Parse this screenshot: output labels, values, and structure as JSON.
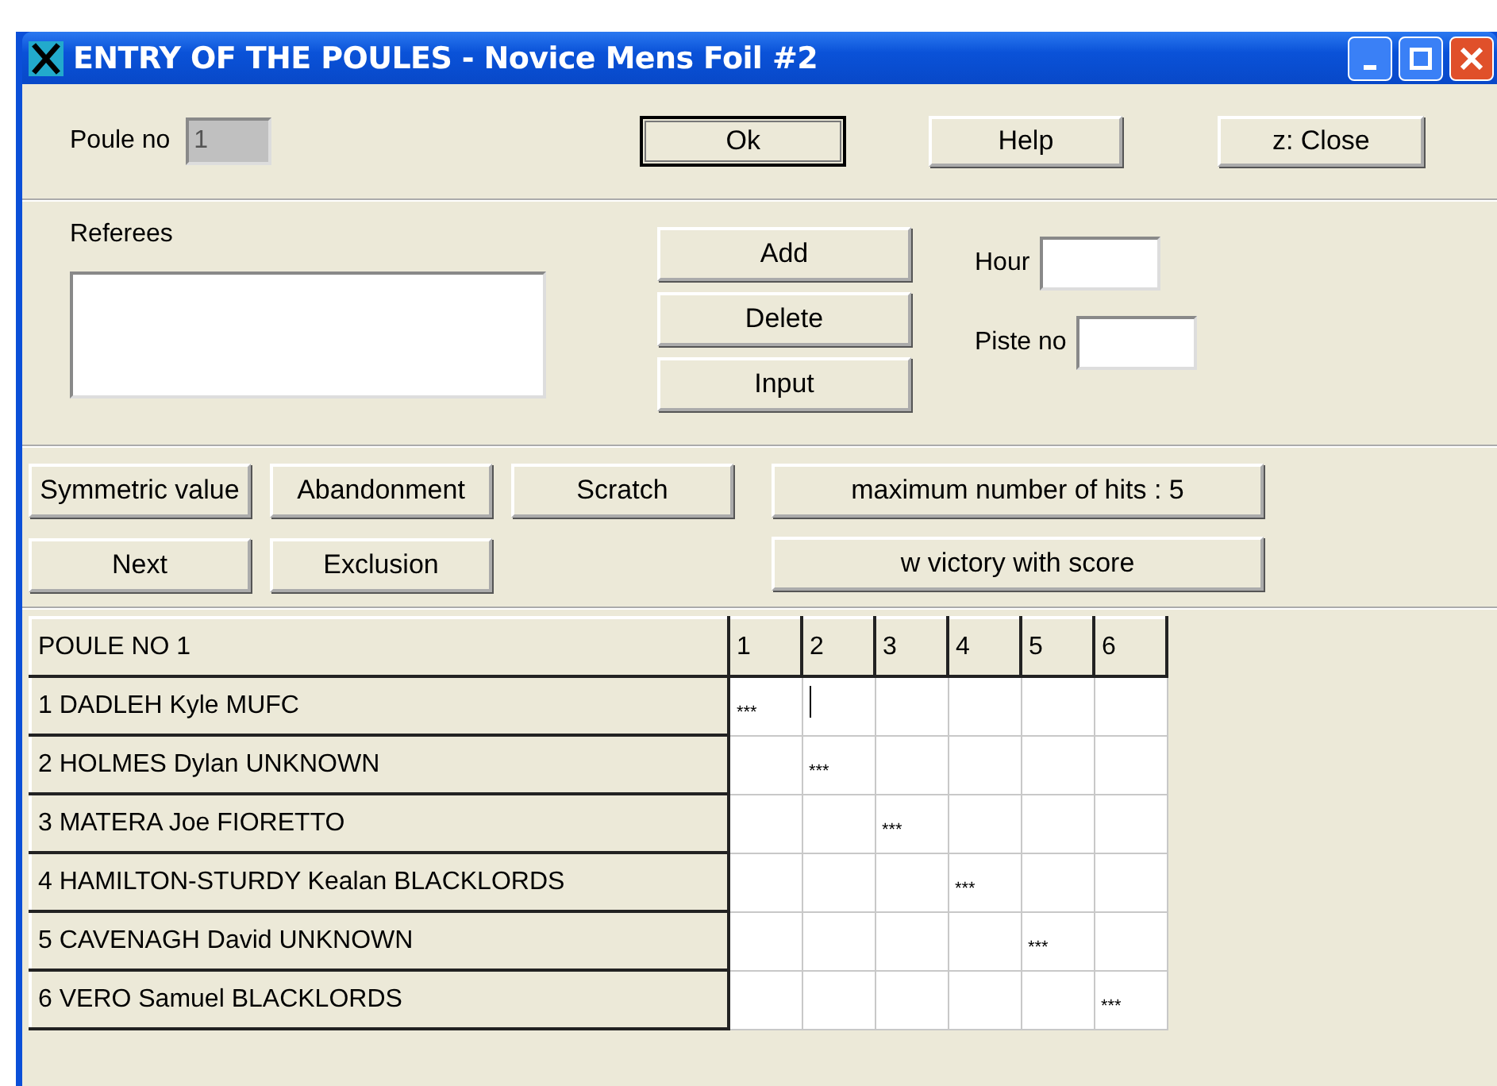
{
  "window": {
    "title": "ENTRY OF THE POULES - Novice Mens Foil #2"
  },
  "poule": {
    "label": "Poule no",
    "value": "1",
    "disabled": true
  },
  "top_buttons": [
    {
      "label": "Ok",
      "default": true
    },
    {
      "label": "Help",
      "default": false
    },
    {
      "label": "z: Close",
      "default": false
    }
  ],
  "referees": {
    "label": "Referees"
  },
  "referee_buttons": [
    "Add",
    "Delete",
    "Input"
  ],
  "hour": {
    "label": "Hour"
  },
  "piste": {
    "label": "Piste no"
  },
  "action_buttons": [
    "Symmetric value",
    "Abandonment",
    "Scratch",
    "Next",
    "Exclusion"
  ],
  "hits_button": "maximum number of hits : 5",
  "victory_button": "w victory with score",
  "grid": {
    "title": "POULE NO 1",
    "columns": [
      "1",
      "2",
      "3",
      "4",
      "5",
      "6"
    ],
    "rows": [
      {
        "label": "1  DADLEH Kyle  MUFC",
        "cells": [
          {
            "text": "***",
            "focused": false
          },
          {
            "focused": true
          },
          {
            "focused": false
          },
          {
            "focused": false
          },
          {
            "focused": false
          },
          {
            "focused": false
          }
        ]
      },
      {
        "label": "2  HOLMES Dylan  UNKNOWN",
        "cells": [
          {
            "focused": false
          },
          {
            "text": "***",
            "focused": false
          },
          {
            "focused": false
          },
          {
            "focused": false
          },
          {
            "focused": false
          },
          {
            "focused": false
          }
        ]
      },
      {
        "label": "3  MATERA Joe  FIORETTO",
        "cells": [
          {
            "focused": false
          },
          {
            "focused": false
          },
          {
            "text": "***",
            "focused": false
          },
          {
            "focused": false
          },
          {
            "focused": false
          },
          {
            "focused": false
          }
        ]
      },
      {
        "label": "4  HAMILTON-STURDY Kealan  BLACKLORDS",
        "cells": [
          {
            "focused": false
          },
          {
            "focused": false
          },
          {
            "focused": false
          },
          {
            "text": "***",
            "focused": false
          },
          {
            "focused": false
          },
          {
            "focused": false
          }
        ]
      },
      {
        "label": "5  CAVENAGH David  UNKNOWN",
        "cells": [
          {
            "focused": false
          },
          {
            "focused": false
          },
          {
            "focused": false
          },
          {
            "focused": false
          },
          {
            "text": "***",
            "focused": false
          },
          {
            "focused": false
          }
        ]
      },
      {
        "label": "6  VERO Samuel  BLACKLORDS",
        "cells": [
          {
            "focused": false
          },
          {
            "focused": false
          },
          {
            "focused": false
          },
          {
            "focused": false
          },
          {
            "focused": false
          },
          {
            "text": "***",
            "focused": false
          }
        ]
      }
    ]
  }
}
